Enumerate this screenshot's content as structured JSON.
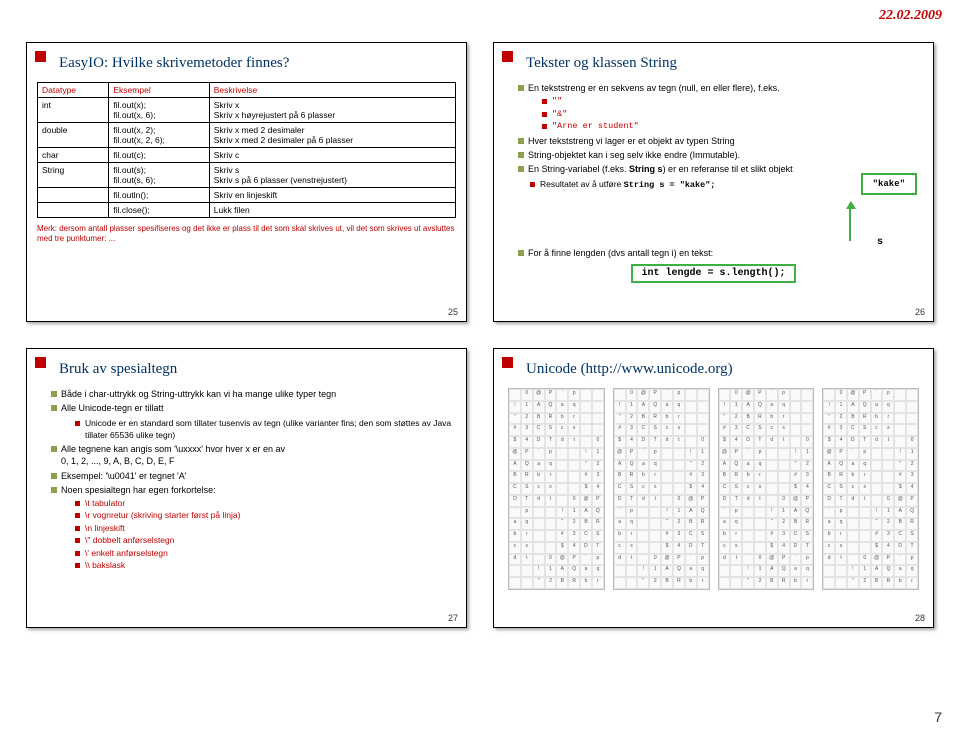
{
  "page": {
    "date": "22.02.2009",
    "number": "7"
  },
  "slide25": {
    "title": "EasyIO: Hvilke skrivemetoder finnes?",
    "number": "25",
    "headers": [
      "Datatype",
      "Eksempel",
      "Beskrivelse"
    ],
    "rows": [
      {
        "type": "int",
        "ex": "fil.out(x);\nfil.out(x, 6);",
        "desc": "Skriv x\nSkriv x høyrejustert på 6 plasser"
      },
      {
        "type": "double",
        "ex": "fil.out(x, 2);\nfil.out(x, 2, 6);",
        "desc": "Skriv x med 2 desimaler\nSkriv x med 2 desimaler på 6 plasser"
      },
      {
        "type": "char",
        "ex": "fil.out(c);",
        "desc": "Skriv c"
      },
      {
        "type": "String",
        "ex": "fil.out(s);\nfil.out(s, 6);",
        "desc": "Skriv s\nSkriv s på 6 plasser (venstrejustert)"
      },
      {
        "type": "",
        "ex": "fil.outln();",
        "desc": "Skriv en linjeskift"
      },
      {
        "type": "",
        "ex": "fil.close();",
        "desc": "Lukk filen"
      }
    ],
    "merk": "Merk: dersom antall plasser spesifiseres og det ikke er plass til det som skal skrives ut, vil det som skrives ut avsluttes med tre punktumer: ..."
  },
  "slide26": {
    "title": "Tekster og klassen String",
    "number": "26",
    "b1": "En tekststreng er en sekvens av tegn (null, en eller flere), f.eks.",
    "s1a": "\"\"",
    "s1b": "\"&\"",
    "s1c": "\"Arne er student\"",
    "b2": "Hver tekststreng vi lager er et objekt av typen String",
    "b3": "String-objektet kan i seg selv ikke endre (Immutable).",
    "b4_pre": "En String-variabel (f.eks. ",
    "b4_bold": "String s",
    "b4_post": ") er en referanse til et slikt objekt",
    "b5_pre": "Resultatet av å utføre ",
    "b5_code": "String s = \"kake\";",
    "kake": "\"kake\"",
    "s_label": "s",
    "b6": "For å finne lengden (dvs antall tegn i) en tekst:",
    "code_len": "int lengde = s.length();"
  },
  "slide27": {
    "title": "Bruk av spesialtegn",
    "number": "27",
    "b1": "Både i char-uttrykk og String-uttrykk kan vi ha mange ulike typer tegn",
    "b2": "Alle Unicode-tegn er tillatt",
    "b2s": "Unicode er en standard som tillater tusenvis av tegn (ulike varianter fins; den som støttes av Java tillater 65536 ulike tegn)",
    "b3": "Alle tegnene kan angis som '\\uxxxx' hvor hver x er en av\n        0, 1, 2, ..., 9, A, B, C, D, E, F",
    "b4": "Eksempel: '\\u0041' er tegnet 'A'",
    "b5": "Noen spesialtegn har egen forkortelse:",
    "s5a": "\\t tabulator",
    "s5b": "\\r vognretur (skriving starter først på linja)",
    "s5c": "\\n linjeskift",
    "s5d": "\\\" dobbelt anførselstegn",
    "s5e": "\\' enkelt anførselstegn",
    "s5f": "\\\\ bakslask"
  },
  "slide28": {
    "title": "Unicode (http://www.unicode.org)",
    "number": "28"
  }
}
